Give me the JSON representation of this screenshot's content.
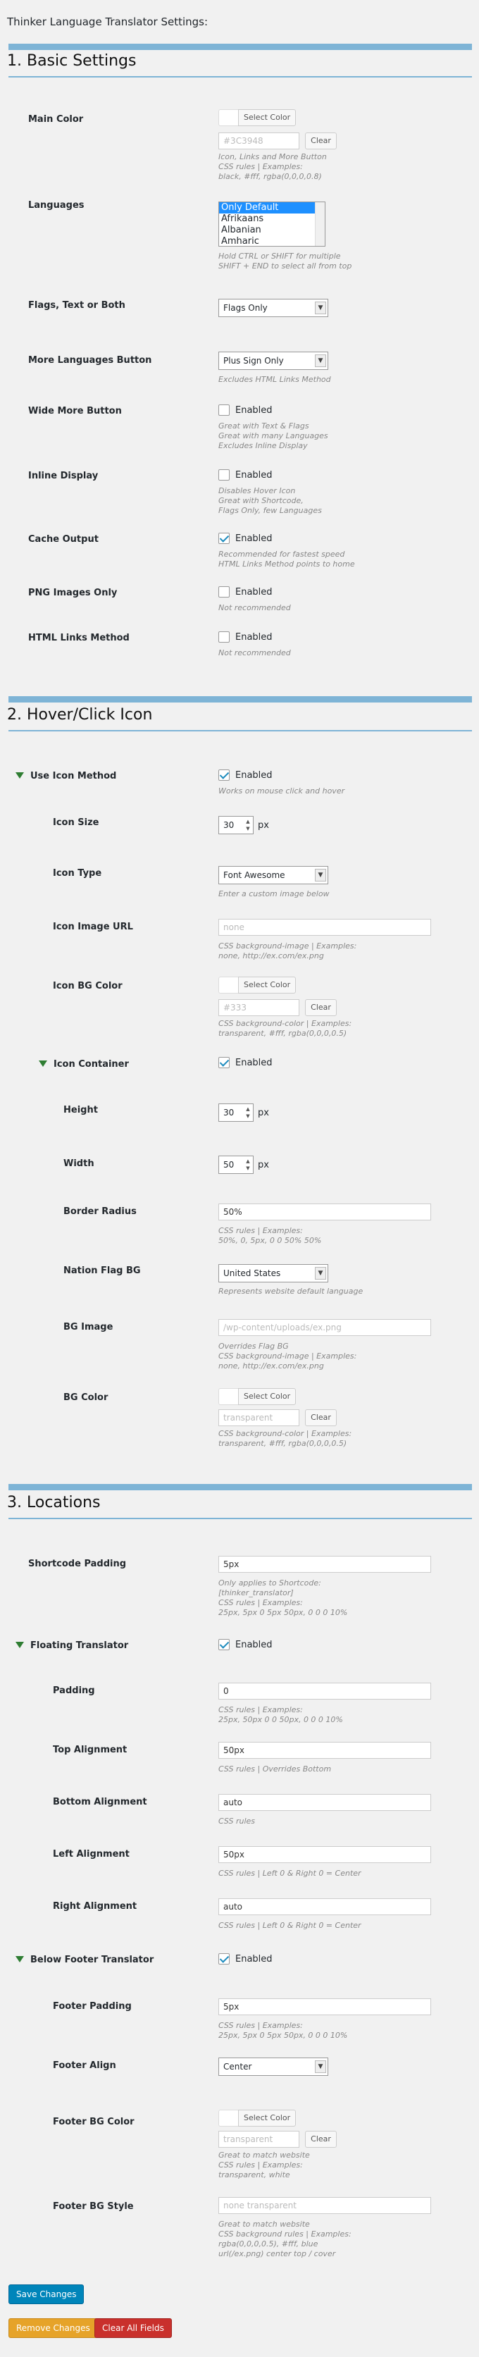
{
  "page_title": "Thinker Language Translator Settings:",
  "sections": {
    "basic": "1. Basic Settings",
    "hover": "2. Hover/Click Icon",
    "locations": "3. Locations"
  },
  "common": {
    "select_color": "Select Color",
    "clear": "Clear",
    "enabled": "Enabled",
    "px": "px"
  },
  "basic": {
    "main_color": {
      "label": "Main Color",
      "placeholder": "#3C3948",
      "hint": "Icon, Links and More Button\nCSS rules | Examples:\nblack, #fff, rgba(0,0,0,0.8)"
    },
    "languages": {
      "label": "Languages",
      "options": [
        "Only Default",
        "Afrikaans",
        "Albanian",
        "Amharic"
      ],
      "hint": "Hold CTRL or SHIFT for multiple\nSHIFT + END to select all from top"
    },
    "flags_text": {
      "label": "Flags, Text or Both",
      "value": "Flags Only"
    },
    "more_button": {
      "label": "More Languages Button",
      "value": "Plus Sign Only",
      "hint": "Excludes HTML Links Method"
    },
    "wide_more": {
      "label": "Wide More Button",
      "hint": "Great with Text & Flags\nGreat with many Languages\nExcludes Inline Display"
    },
    "inline_display": {
      "label": "Inline Display",
      "hint": "Disables Hover Icon\nGreat with Shortcode,\nFlags Only, few Languages"
    },
    "cache_output": {
      "label": "Cache Output",
      "hint": "Recommended for fastest speed\nHTML Links Method points to home"
    },
    "png_only": {
      "label": "PNG Images Only",
      "hint": "Not recommended"
    },
    "html_links": {
      "label": "HTML Links Method",
      "hint": "Not recommended"
    }
  },
  "hover": {
    "use_icon": {
      "label": "Use Icon Method",
      "hint": "Works on mouse click and hover"
    },
    "icon_size": {
      "label": "Icon Size",
      "value": "30"
    },
    "icon_type": {
      "label": "Icon Type",
      "value": "Font Awesome",
      "hint": "Enter a custom image below"
    },
    "icon_image_url": {
      "label": "Icon Image URL",
      "placeholder": "none",
      "hint": "CSS background-image | Examples:\nnone, http://ex.com/ex.png"
    },
    "icon_bg_color": {
      "label": "Icon BG Color",
      "placeholder": "#333",
      "hint": "CSS background-color | Examples:\ntransparent, #fff, rgba(0,0,0,0.5)"
    },
    "icon_container": {
      "label": "Icon Container"
    },
    "height": {
      "label": "Height",
      "value": "30"
    },
    "width": {
      "label": "Width",
      "value": "50"
    },
    "border_radius": {
      "label": "Border Radius",
      "value": "50%",
      "hint": "CSS rules | Examples:\n50%, 0, 5px, 0 0 50% 50%"
    },
    "nation_flag_bg": {
      "label": "Nation Flag BG",
      "value": "United States",
      "hint": "Represents website default language"
    },
    "bg_image": {
      "label": "BG Image",
      "placeholder": "/wp-content/uploads/ex.png",
      "hint": "Overrides Flag BG\nCSS background-image | Examples:\nnone, http://ex.com/ex.png"
    },
    "bg_color": {
      "label": "BG Color",
      "placeholder": "transparent",
      "hint": "CSS background-color | Examples:\ntransparent, #fff, rgba(0,0,0,0.5)"
    }
  },
  "locations": {
    "shortcode_padding": {
      "label": "Shortcode Padding",
      "value": "5px",
      "hint": "Only applies to Shortcode:\n[thinker_translator]\nCSS rules | Examples:\n25px, 5px 0 5px 50px, 0 0 0 10%"
    },
    "floating": {
      "label": "Floating Translator"
    },
    "padding": {
      "label": "Padding",
      "value": "0",
      "hint": "CSS rules | Examples:\n25px, 50px 0 0 50px, 0 0 0 10%"
    },
    "top_align": {
      "label": "Top Alignment",
      "value": "50px",
      "hint": "CSS rules | Overrides Bottom"
    },
    "bottom_align": {
      "label": "Bottom Alignment",
      "value": "auto",
      "hint": "CSS rules"
    },
    "left_align": {
      "label": "Left Alignment",
      "value": "50px",
      "hint": "CSS rules | Left 0 & Right 0 = Center"
    },
    "right_align": {
      "label": "Right Alignment",
      "value": "auto",
      "hint": "CSS rules | Left 0 & Right 0 = Center"
    },
    "below_footer": {
      "label": "Below Footer Translator"
    },
    "footer_padding": {
      "label": "Footer Padding",
      "value": "5px",
      "hint": "CSS rules | Examples:\n25px, 5px 0 5px 50px, 0 0 0 10%"
    },
    "footer_align": {
      "label": "Footer Align",
      "value": "Center"
    },
    "footer_bg_color": {
      "label": "Footer BG Color",
      "placeholder": "transparent",
      "hint": "Great to match website\nCSS rules | Examples:\ntransparent, white"
    },
    "footer_bg_style": {
      "label": "Footer BG Style",
      "placeholder": "none transparent",
      "hint": "Great to match website\nCSS background rules | Examples:\nrgba(0,0,0,0.5), #fff, blue\nurl(/ex.png) center top / cover"
    }
  },
  "buttons": {
    "save": "Save Changes",
    "remove": "Remove Changes",
    "clear_all": "Clear All Fields"
  }
}
